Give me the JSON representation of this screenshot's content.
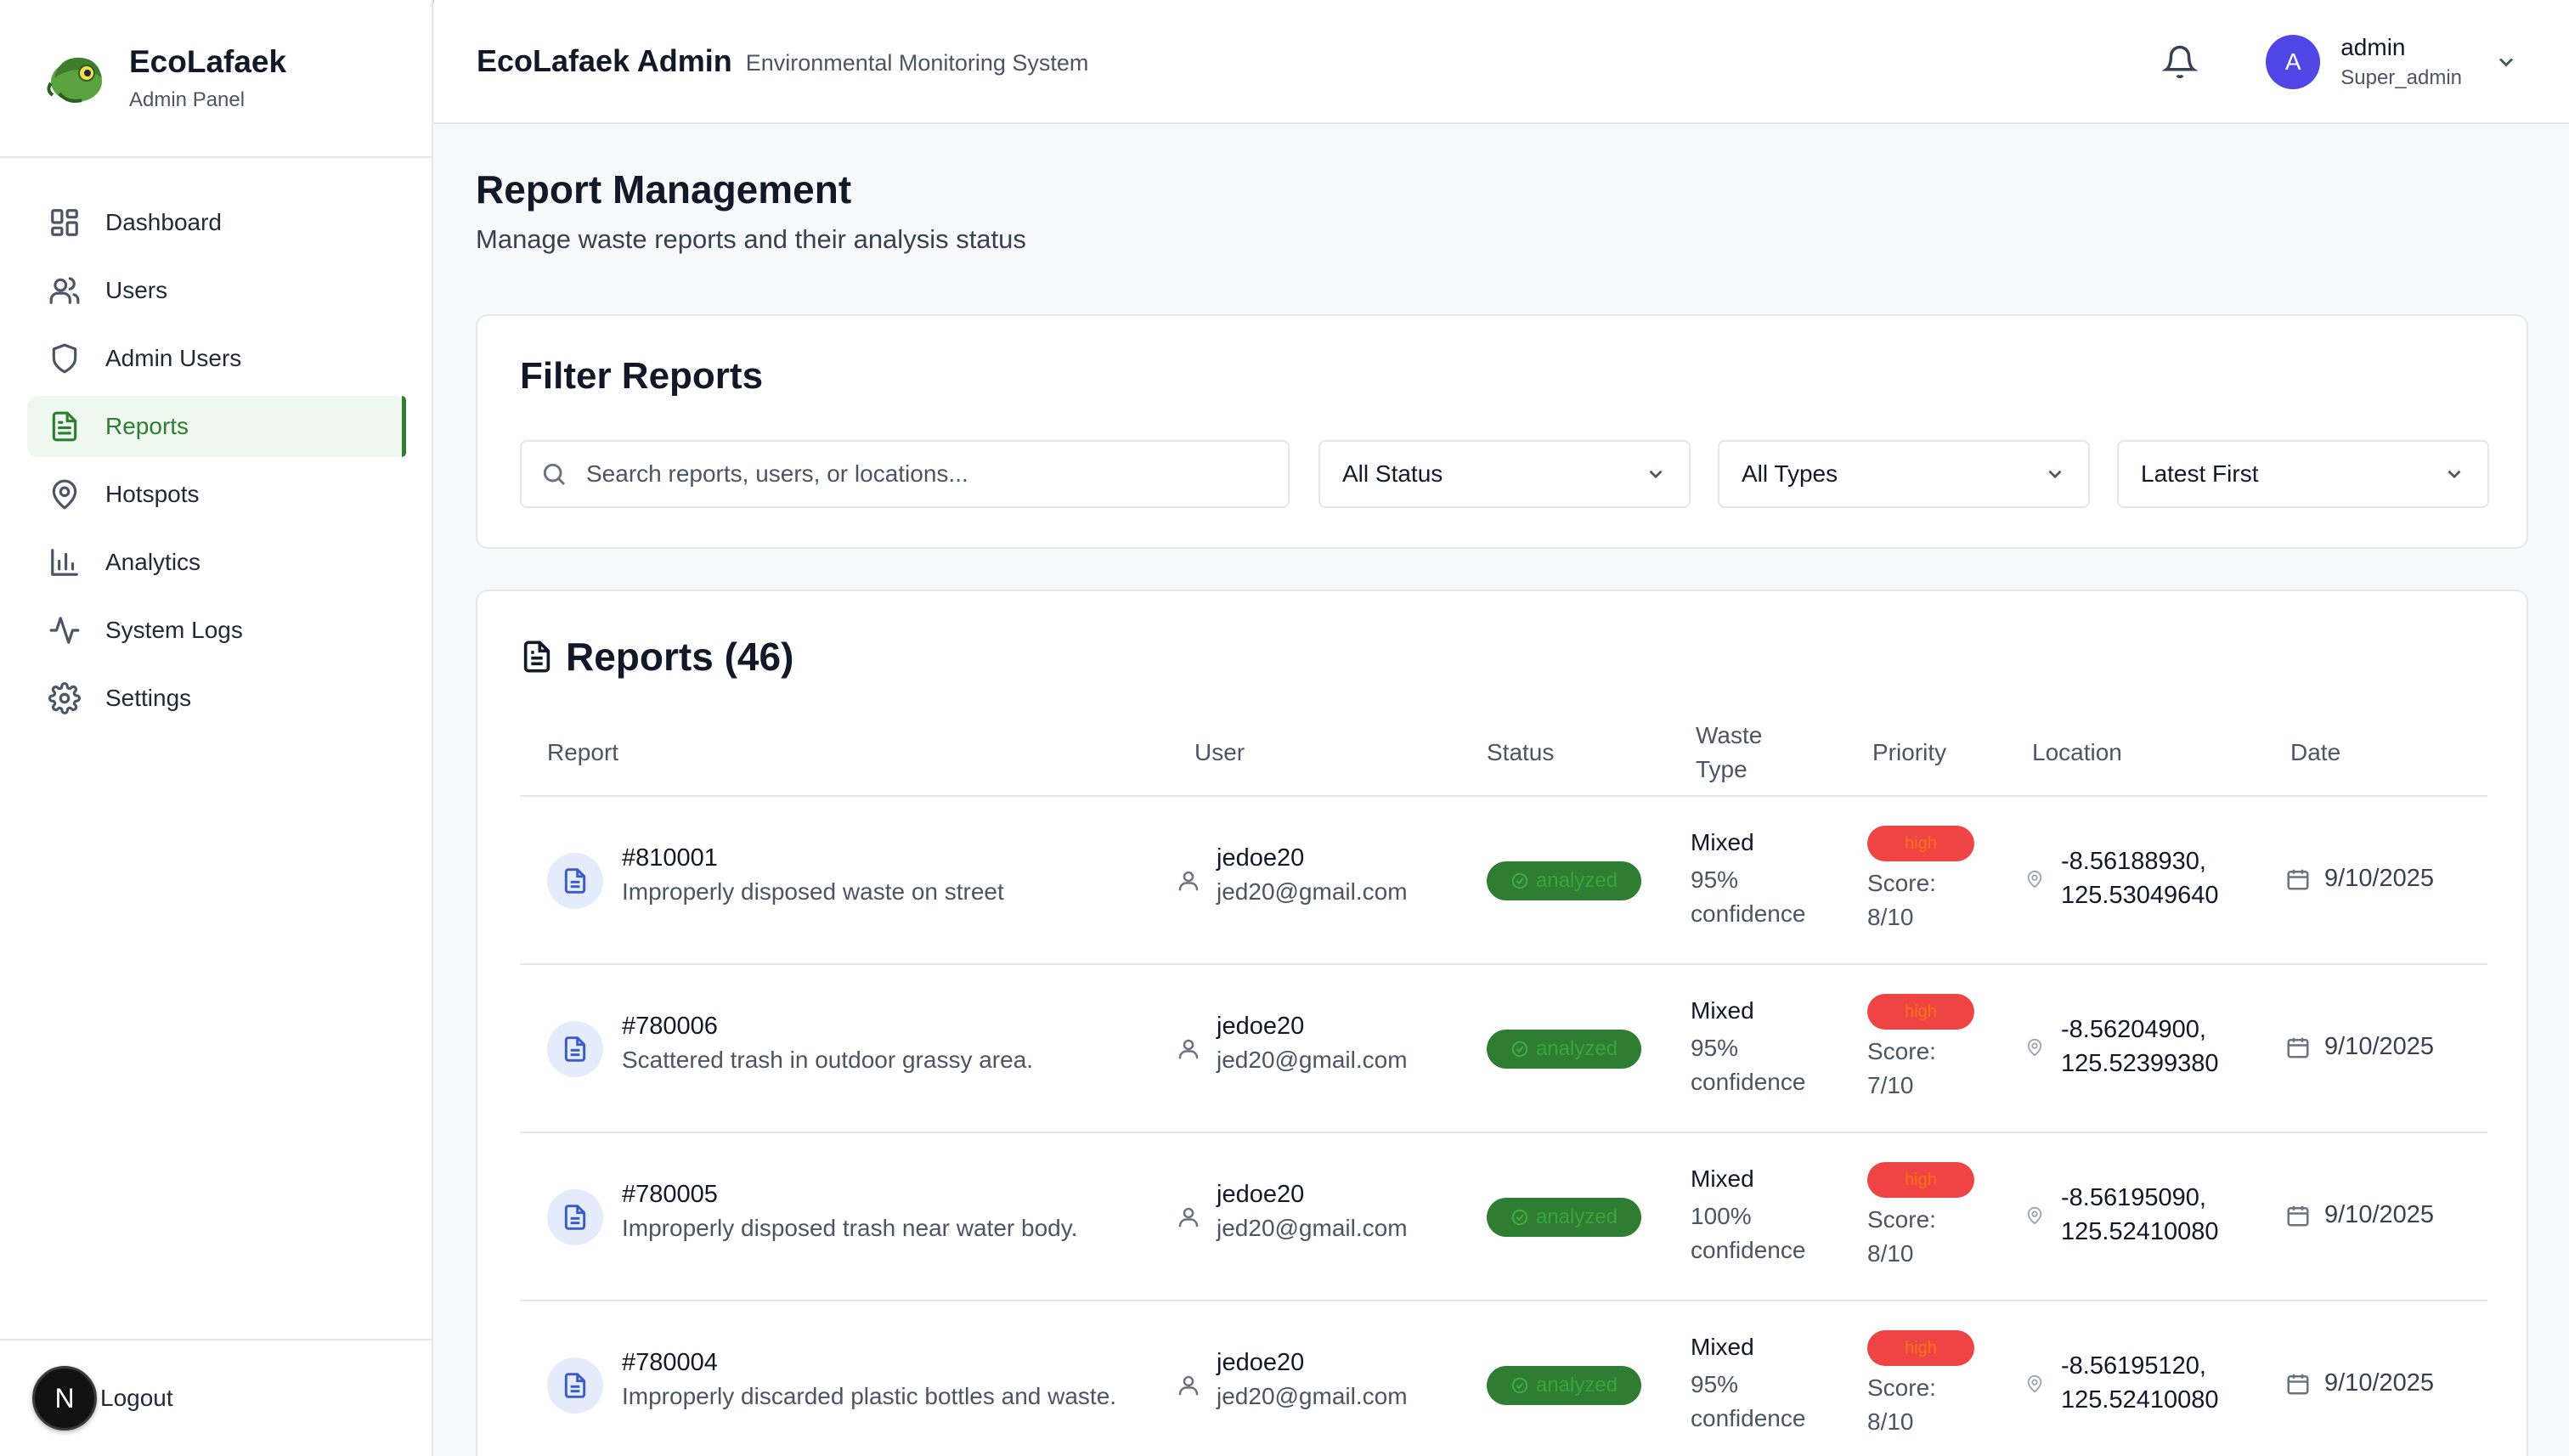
{
  "sidebar": {
    "brand_title": "EcoLafaek",
    "brand_subtitle": "Admin Panel",
    "items": [
      {
        "label": "Dashboard",
        "icon": "dashboard-icon"
      },
      {
        "label": "Users",
        "icon": "users-icon"
      },
      {
        "label": "Admin Users",
        "icon": "shield-icon"
      },
      {
        "label": "Reports",
        "icon": "file-text-icon",
        "active": true
      },
      {
        "label": "Hotspots",
        "icon": "map-pin-icon"
      },
      {
        "label": "Analytics",
        "icon": "bar-chart-icon"
      },
      {
        "label": "System Logs",
        "icon": "activity-icon"
      },
      {
        "label": "Settings",
        "icon": "gear-icon"
      }
    ],
    "footer_badge": "N",
    "logout_label": "Logout"
  },
  "header": {
    "title": "EcoLafaek Admin",
    "subtitle": "Environmental Monitoring System",
    "user": {
      "initial": "A",
      "name": "admin",
      "role": "Super_admin"
    }
  },
  "main": {
    "title": "Report Management",
    "subtitle": "Manage waste reports and their analysis status"
  },
  "filters": {
    "title": "Filter Reports",
    "search_placeholder": "Search reports, users, or locations...",
    "status_value": "All Status",
    "type_value": "All Types",
    "sort_value": "Latest First"
  },
  "reports": {
    "title": "Reports (46)",
    "columns": {
      "report": "Report",
      "user": "User",
      "status": "Status",
      "waste_type_line1": "Waste",
      "waste_type_line2": "Type",
      "priority": "Priority",
      "location": "Location",
      "date": "Date"
    },
    "rows": [
      {
        "id": "#810001",
        "desc": "Improperly disposed waste on street",
        "user": "jedoe20",
        "email": "jed20@gmail.com",
        "status": "analyzed",
        "waste_type": "Mixed",
        "confidence": "95% confidence",
        "priority": "high",
        "score": "Score: 8/10",
        "lat": "-8.56188930,",
        "lng": "125.53049640",
        "date": "9/10/2025"
      },
      {
        "id": "#780006",
        "desc": "Scattered trash in outdoor grassy area.",
        "user": "jedoe20",
        "email": "jed20@gmail.com",
        "status": "analyzed",
        "waste_type": "Mixed",
        "confidence": "95% confidence",
        "priority": "high",
        "score": "Score: 7/10",
        "lat": "-8.56204900,",
        "lng": "125.52399380",
        "date": "9/10/2025"
      },
      {
        "id": "#780005",
        "desc": "Improperly disposed trash near water body.",
        "user": "jedoe20",
        "email": "jed20@gmail.com",
        "status": "analyzed",
        "waste_type": "Mixed",
        "confidence": "100% confidence",
        "priority": "high",
        "score": "Score: 8/10",
        "lat": "-8.56195090,",
        "lng": "125.52410080",
        "date": "9/10/2025"
      },
      {
        "id": "#780004",
        "desc": "Improperly discarded plastic bottles and waste.",
        "user": "jedoe20",
        "email": "jed20@gmail.com",
        "status": "analyzed",
        "waste_type": "Mixed",
        "confidence": "95% confidence",
        "priority": "high",
        "score": "Score: 8/10",
        "lat": "-8.56195120,",
        "lng": "125.52410080",
        "date": "9/10/2025"
      }
    ]
  },
  "colors": {
    "accent_green": "#2e7d32",
    "avatar_indigo": "#4f46e5",
    "priority_red": "#ef4444"
  }
}
